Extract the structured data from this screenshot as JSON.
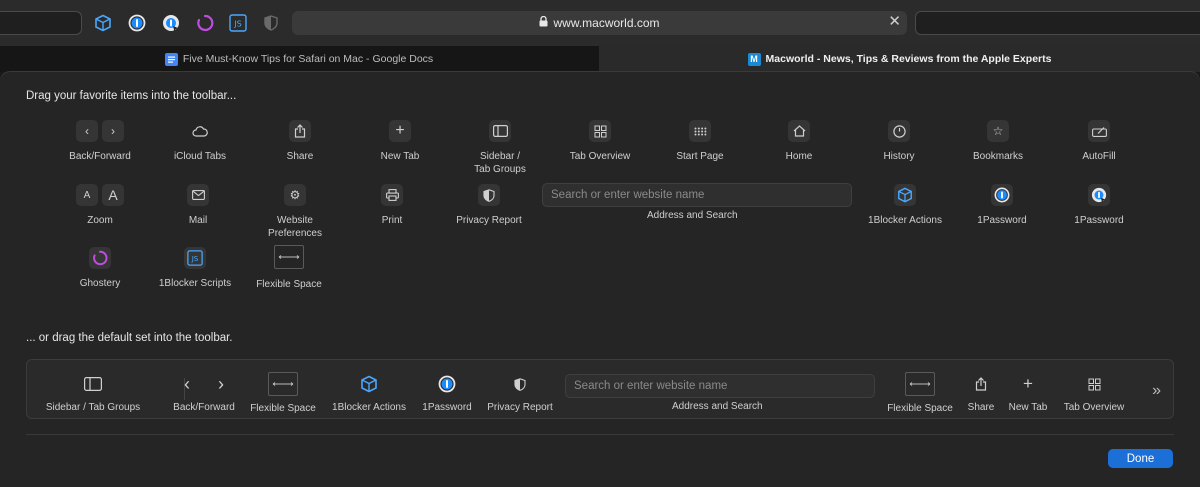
{
  "browser": {
    "url": "www.macworld.com",
    "tabs": [
      {
        "title": "Five Must-Know Tips for Safari on Mac - Google Docs",
        "favicon": "docs-icon",
        "active": false
      },
      {
        "title": "Macworld - News, Tips & Reviews from the Apple Experts",
        "favicon": "M",
        "active": true
      }
    ],
    "toolbar_icons": [
      "1blocker-icon",
      "1password-icon",
      "1password-mini-icon",
      "ghostery-icon",
      "1blocker-scripts-icon",
      "privacy-shield-icon"
    ]
  },
  "customize": {
    "favorites_heading": "Drag your favorite items into the toolbar...",
    "default_heading": "... or drag the default set into the toolbar.",
    "search_placeholder": "Search or enter website name",
    "items": {
      "back_forward": "Back/Forward",
      "icloud_tabs": "iCloud Tabs",
      "share": "Share",
      "new_tab": "New Tab",
      "sidebar": "Sidebar /\nTab Groups",
      "tab_overview": "Tab Overview",
      "start_page": "Start Page",
      "home": "Home",
      "history": "History",
      "bookmarks": "Bookmarks",
      "autofill": "AutoFill",
      "zoom": "Zoom",
      "mail": "Mail",
      "website_prefs": "Website\nPreferences",
      "print": "Print",
      "privacy_report": "Privacy Report",
      "address_search": "Address and Search",
      "blocker_actions": "1Blocker Actions",
      "onepassword": "1Password",
      "onepassword_mini": "1Password",
      "ghostery": "Ghostery",
      "blocker_scripts": "1Blocker Scripts",
      "flexible_space": "Flexible Space"
    },
    "defaults": {
      "sidebar": "Sidebar / Tab Groups",
      "back_forward": "Back/Forward",
      "flexible_space_1": "Flexible Space",
      "blocker_actions": "1Blocker Actions",
      "onepassword": "1Password",
      "privacy_report": "Privacy Report",
      "address_search": "Address and Search",
      "flexible_space_2": "Flexible Space",
      "share": "Share",
      "new_tab": "New Tab",
      "tab_overview": "Tab Overview"
    },
    "done_label": "Done"
  },
  "colors": {
    "accent": "#1d6fd8",
    "onepassword_blue": "#1a8cff",
    "blocker_blue": "#4aa8ff",
    "ghostery_purple": "#c04de0"
  }
}
